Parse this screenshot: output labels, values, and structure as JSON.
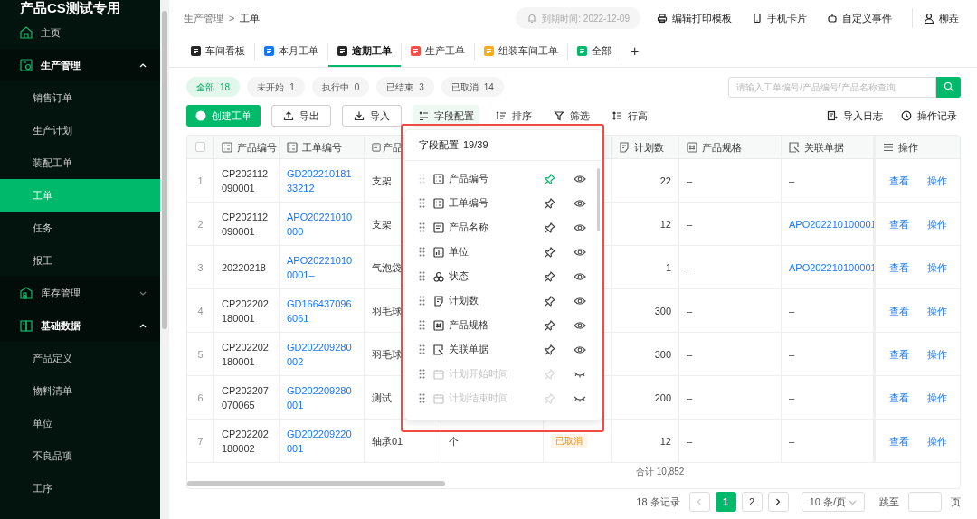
{
  "sidebar": {
    "title": "产品CS测试专用",
    "items": [
      {
        "label": "主页",
        "selected": false
      },
      {
        "label": "生产管理",
        "selected": false,
        "expanded": true,
        "children": [
          {
            "label": "销售订单",
            "selected": false
          },
          {
            "label": "生产计划",
            "selected": false
          },
          {
            "label": "装配工单",
            "selected": false
          },
          {
            "label": "工单",
            "selected": true
          },
          {
            "label": "任务",
            "selected": false
          },
          {
            "label": "报工",
            "selected": false
          }
        ]
      },
      {
        "label": "库存管理",
        "selected": false,
        "expanded": false
      },
      {
        "label": "基础数据",
        "selected": false,
        "expanded": true,
        "children": [
          {
            "label": "产品定义",
            "selected": false
          },
          {
            "label": "物料清单",
            "selected": false
          },
          {
            "label": "单位",
            "selected": false
          },
          {
            "label": "不良品项",
            "selected": false
          },
          {
            "label": "工序",
            "selected": false
          }
        ]
      }
    ]
  },
  "header": {
    "breadcrumb": [
      "生产管理",
      "工单"
    ],
    "separator": ">",
    "due_notice": "到期时间: 2022-12-09",
    "actions": [
      "编辑打印模板",
      "手机卡片",
      "自定义事件"
    ],
    "user": "柳垚"
  },
  "tabs": [
    {
      "label": "车间看板",
      "color": "#262626",
      "selected": false
    },
    {
      "label": "本月工单",
      "color": "#1677ff",
      "selected": false
    },
    {
      "label": "逾期工单",
      "color": "#262626",
      "selected": true
    },
    {
      "label": "生产工单",
      "color": "#f5504a",
      "selected": false
    },
    {
      "label": "组装车间工单",
      "color": "#faad14",
      "selected": false
    },
    {
      "label": "全部",
      "color": "#00b96b",
      "selected": false
    }
  ],
  "add_tab": "+",
  "status_filters": [
    {
      "label": "全部",
      "count": "18",
      "selected": true
    },
    {
      "label": "未开始",
      "count": "1",
      "selected": false
    },
    {
      "label": "执行中",
      "count": "0",
      "selected": false
    },
    {
      "label": "已结束",
      "count": "3",
      "selected": false
    },
    {
      "label": "已取消",
      "count": "14",
      "selected": false
    }
  ],
  "search": {
    "placeholder": "请输入工单编号/产品编号/产品名称查询"
  },
  "toolbar": {
    "left": [
      {
        "label": "创建工单",
        "kind": "primary",
        "active": false
      },
      {
        "label": "导出",
        "kind": "outline",
        "active": false
      },
      {
        "label": "导入",
        "kind": "outline",
        "active": false
      },
      {
        "label": "字段配置",
        "kind": "text",
        "active": true
      },
      {
        "label": "排序",
        "kind": "text",
        "active": false
      },
      {
        "label": "筛选",
        "kind": "text",
        "active": false
      },
      {
        "label": "行高",
        "kind": "text",
        "active": false
      }
    ],
    "right": [
      "导入日志",
      "操作记录"
    ]
  },
  "table": {
    "select_all": {
      "checked": false
    },
    "columns": [
      {
        "label": "产品编号"
      },
      {
        "label": "工单编号"
      },
      {
        "label": "产品"
      },
      null,
      null,
      {
        "label": "计划数"
      },
      {
        "label": "产品规格"
      },
      {
        "label": "关联单据"
      },
      {
        "label": "操作"
      }
    ],
    "rows": [
      {
        "index": "1",
        "product_code": "CP202112090001",
        "order_no": "GD20221018133212",
        "product_name": "支架",
        "planned_qty": "22",
        "spec": "–",
        "related": {
          "text": "–",
          "link": false
        },
        "actions": [
          "查看",
          "操作"
        ]
      },
      {
        "index": "2",
        "product_code": "CP202112090001",
        "order_no": "APO20221010000",
        "product_name": "支架",
        "planned_qty": "12",
        "spec": "–",
        "related": {
          "text": "APO202210100001",
          "link": true
        },
        "actions": [
          "查看",
          "操作"
        ]
      },
      {
        "index": "3",
        "product_code": "20220218",
        "order_no": "APO202210100001–",
        "product_name": "气泡袋",
        "planned_qty": "1",
        "spec": "–",
        "related": {
          "text": "APO202210100001",
          "link": true
        },
        "actions": [
          "查看",
          "操作"
        ]
      },
      {
        "index": "4",
        "product_code": "CP202202180001",
        "order_no": "GD1664370966061",
        "product_name": "羽毛球",
        "planned_qty": "300",
        "spec": "–",
        "related": {
          "text": "–",
          "link": false
        },
        "actions": [
          "查看",
          "操作"
        ]
      },
      {
        "index": "5",
        "product_code": "CP202202180001",
        "order_no": "GD202209280002",
        "product_name": "羽毛球",
        "planned_qty": "300",
        "spec": "–",
        "related": {
          "text": "–",
          "link": false
        },
        "actions": [
          "查看",
          "操作"
        ]
      },
      {
        "index": "6",
        "product_code": "CP202207070065",
        "order_no": "GD202209280001",
        "product_name": "测试",
        "planned_qty": "200",
        "spec": "–",
        "related": {
          "text": "–",
          "link": false
        },
        "actions": [
          "查看",
          "操作"
        ]
      },
      {
        "index": "7",
        "product_code": "CP202202180002",
        "order_no": "GD202209220001",
        "product_name": "轴承01",
        "unit": "个",
        "status": "已取消",
        "planned_qty": "12",
        "spec": "–",
        "related": {
          "text": "–",
          "link": false
        },
        "actions": [
          "查看",
          "操作"
        ]
      }
    ],
    "total": "合计 10,852"
  },
  "pagination": {
    "total": "18 条记录",
    "pages": [
      {
        "label": "1",
        "selected": true
      },
      {
        "label": "2",
        "selected": false
      }
    ],
    "page_size": "10 条/页",
    "jump_label": "跳至",
    "page_suffix": "页"
  },
  "field_config": {
    "title": "字段配置",
    "count": "19/39",
    "fields": [
      {
        "label": "产品编号",
        "draggable": false,
        "pinned": true,
        "visible": true
      },
      {
        "label": "工单编号",
        "draggable": true,
        "pinned": false,
        "visible": true
      },
      {
        "label": "产品名称",
        "draggable": true,
        "pinned": false,
        "visible": true
      },
      {
        "label": "单位",
        "draggable": true,
        "pinned": false,
        "visible": true
      },
      {
        "label": "状态",
        "draggable": true,
        "pinned": false,
        "visible": true
      },
      {
        "label": "计划数",
        "draggable": true,
        "pinned": false,
        "visible": true
      },
      {
        "label": "产品规格",
        "draggable": true,
        "pinned": false,
        "visible": true
      },
      {
        "label": "关联单据",
        "draggable": true,
        "pinned": false,
        "visible": true
      },
      {
        "label": "计划开始时间",
        "draggable": true,
        "pinned": false,
        "visible": false
      },
      {
        "label": "计划结束时间",
        "draggable": true,
        "pinned": false,
        "visible": false
      }
    ]
  }
}
